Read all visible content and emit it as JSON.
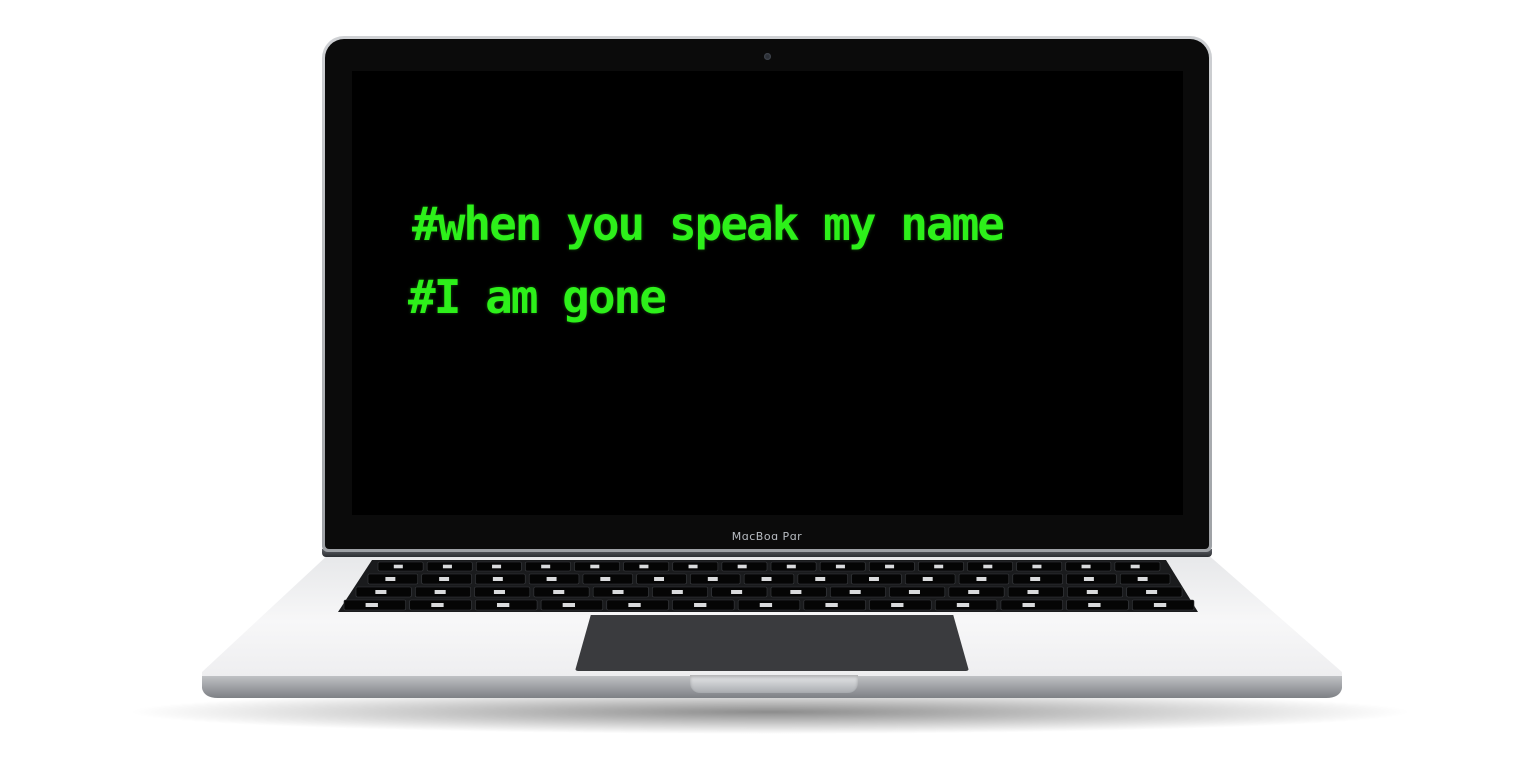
{
  "screen": {
    "lines": [
      "#when you speak my name",
      "#I am gone"
    ],
    "text_color": "#2df01a",
    "background_color": "#000000"
  },
  "device": {
    "brand_label": "MɑcBoɑ Pɑr",
    "lid_color": "#0b0b0b",
    "base_color": "#f2f2f3"
  },
  "icons": {
    "camera": "webcam-icon"
  }
}
